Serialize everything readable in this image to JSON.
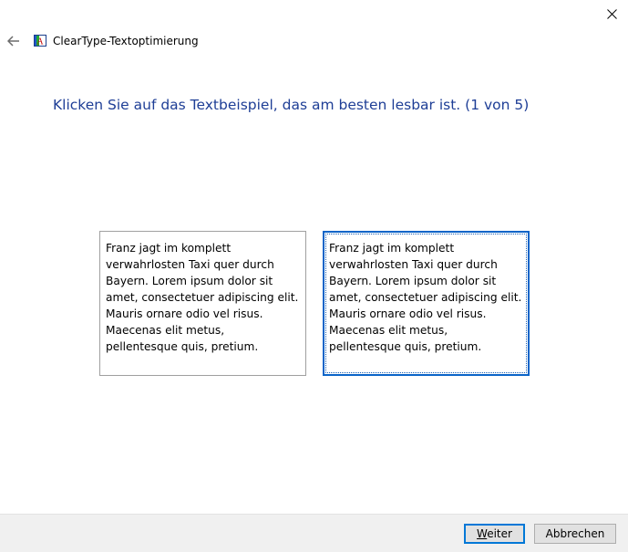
{
  "window": {
    "title": "ClearType-Textoptimierung",
    "close_icon": "close-icon",
    "back_icon": "back-arrow-icon",
    "app_icon": "cleartype-app-icon"
  },
  "main": {
    "instruction": "Klicken Sie auf das Textbeispiel, das am besten lesbar ist. (1 von 5)",
    "samples": [
      {
        "text": "Franz jagt im komplett\nverwahrlosten Taxi quer durch\nBayern. Lorem ipsum dolor sit\namet, consectetuer adipiscing elit.\nMauris ornare odio vel risus.\nMaecenas elit metus,\npellentesque quis, pretium.",
        "selected": false
      },
      {
        "text": "Franz jagt im komplett\nverwahrlosten Taxi quer durch\nBayern. Lorem ipsum dolor sit\namet, consectetuer adipiscing elit.\nMauris ornare odio vel risus.\nMaecenas elit metus,\npellentesque quis, pretium.",
        "selected": true
      }
    ]
  },
  "footer": {
    "next_label_mnemonic": "W",
    "next_label_rest": "eiter",
    "cancel_label": "Abbrechen"
  },
  "colors": {
    "instruction": "#1e3e96",
    "selection_border": "#0a64c8",
    "footer_background": "#f0f0f0",
    "default_button_border": "#0078d7"
  }
}
